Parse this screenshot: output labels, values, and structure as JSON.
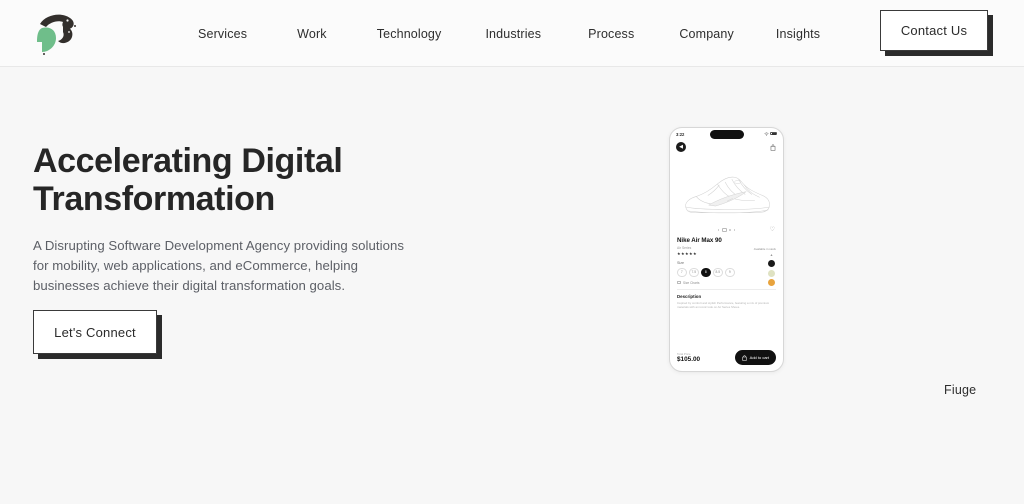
{
  "colors": {
    "page_bg": "#f7f7f7",
    "header_bg": "#fbfbfb",
    "ink": "#262626",
    "muted": "#5c5f66",
    "logo_green": "#6fbe8a",
    "logo_dark": "#332f2c",
    "accent_orange": "#e8a33d",
    "accent_cream": "#dfe2c2"
  },
  "header": {
    "logo_name": "fiuge-logo",
    "nav": [
      {
        "label": "Services"
      },
      {
        "label": "Work"
      },
      {
        "label": "Technology"
      },
      {
        "label": "Industries"
      },
      {
        "label": "Process"
      },
      {
        "label": "Company"
      },
      {
        "label": "Insights"
      }
    ],
    "contact_label": "Contact Us"
  },
  "hero": {
    "headline_line1": "Accelerating Digital",
    "headline_line2": "Transformation",
    "subcopy": "A Disrupting Software Development Agency providing solutions for mobility, web applications, and eCommerce, helping businesses achieve their digital transformation goals.",
    "cta_label": "Let's Connect"
  },
  "phone": {
    "status": {
      "time": "3:22",
      "wifi_icon": "wifi-icon",
      "battery_icon": "battery-icon"
    },
    "app": {
      "back_icon": "back-chevron-icon",
      "bag_icon": "shopping-bag-icon",
      "product_image": "sneaker-line-art",
      "favorite_icon": "heart-icon",
      "title": "Nike Air Max 90",
      "subtitle": "Air Series",
      "rating_stars": "★★★★★",
      "availability": "Available in stock",
      "size_label": "Size",
      "sizes": [
        "7",
        "7.5",
        "8",
        "8.5",
        "9"
      ],
      "selected_size": "8",
      "size_chart_label": "Size Charts",
      "swatches": [
        "#1a1a1a",
        "#dfe2c2",
        "#e8a33d"
      ],
      "description_heading": "Description",
      "description_body": "Inspired by comfort and stylish Performance, featuring a mix of premium materials with an iconic look on Air Series Shoes.",
      "price_label": "Total Price",
      "price": "$105.00",
      "cart_label": "Add to cart",
      "cart_icon": "bag-icon"
    }
  },
  "footer": {
    "brand": "Fiuge"
  }
}
